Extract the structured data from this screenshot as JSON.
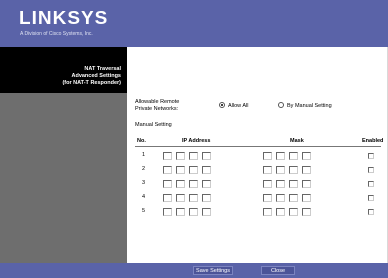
{
  "header": {
    "logo": "LINKSYS",
    "tagline": "A Division of Cisco Systems, Inc."
  },
  "sidebar": {
    "title_lines": [
      "NAT Traversal",
      "Advanced Settings",
      "(for NAT-T Responder)"
    ]
  },
  "form": {
    "keepalive_label_line1": "Allowable Remote",
    "keepalive_label_line2": "Private Networks:",
    "option_allow_all": "Allow All",
    "option_manual": "By Manual Setting",
    "manual_setting_label": "Manual Setting",
    "selected_option": "Allow All"
  },
  "table": {
    "columns": [
      "No.",
      "IP Address",
      "Mask",
      "Enabled"
    ],
    "rows": [
      {
        "no": "1"
      },
      {
        "no": "2"
      },
      {
        "no": "3"
      },
      {
        "no": "4"
      },
      {
        "no": "5"
      }
    ]
  },
  "footer": {
    "save_label": "Save Settings",
    "close_label": "Close"
  },
  "colors": {
    "brand": "#5a63a8",
    "sidebar": "#000000",
    "sidebar_lower": "#6e6e6e"
  }
}
